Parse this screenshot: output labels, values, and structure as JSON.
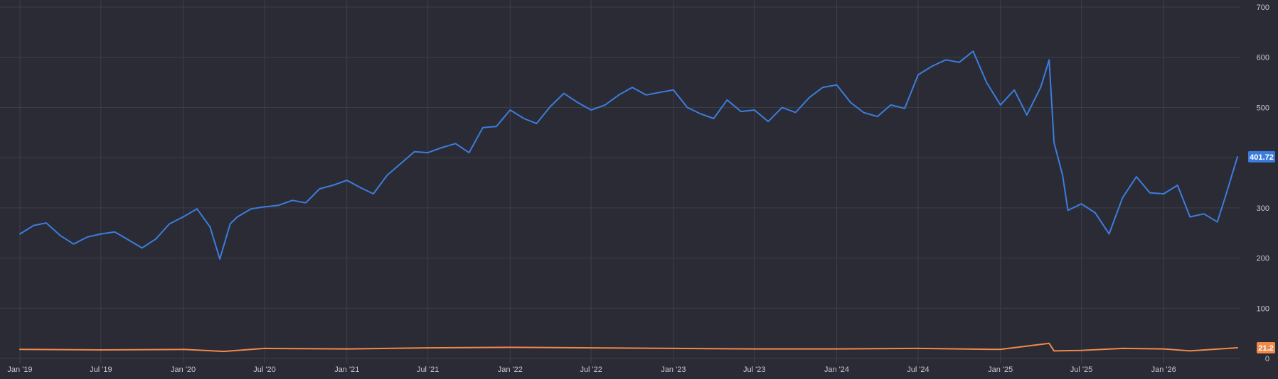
{
  "chart_data": {
    "type": "line",
    "title": "",
    "xlabel": "",
    "ylabel": "",
    "ylim": [
      0,
      700
    ],
    "yticks": [
      0,
      100,
      200,
      300,
      400,
      500,
      600,
      700
    ],
    "xticks": [
      "Jan '19",
      "Jul '19",
      "Jan '20",
      "Jul '20",
      "Jan '21",
      "Jul '21",
      "Jan '22",
      "Jul '22",
      "Jan '23",
      "Jul '23",
      "Jan '24",
      "Jul '24",
      "Jan '25",
      "Jul '25",
      "Jan '26"
    ],
    "xlim": [
      "2019-01-01",
      "2026-06-15"
    ],
    "grid": true,
    "legend": "none",
    "series": [
      {
        "color": "#3b7ddd",
        "last_value_label": "401.72",
        "points": [
          [
            "2019-01-01",
            248
          ],
          [
            "2019-02-01",
            265
          ],
          [
            "2019-03-01",
            270
          ],
          [
            "2019-04-01",
            245
          ],
          [
            "2019-05-01",
            228
          ],
          [
            "2019-06-01",
            242
          ],
          [
            "2019-07-01",
            248
          ],
          [
            "2019-08-01",
            252
          ],
          [
            "2019-09-01",
            236
          ],
          [
            "2019-10-01",
            220
          ],
          [
            "2019-11-01",
            238
          ],
          [
            "2019-12-01",
            268
          ],
          [
            "2020-01-01",
            282
          ],
          [
            "2020-02-01",
            298
          ],
          [
            "2020-03-01",
            262
          ],
          [
            "2020-03-23",
            198
          ],
          [
            "2020-04-15",
            268
          ],
          [
            "2020-05-01",
            282
          ],
          [
            "2020-06-01",
            298
          ],
          [
            "2020-07-01",
            302
          ],
          [
            "2020-08-01",
            305
          ],
          [
            "2020-09-01",
            315
          ],
          [
            "2020-10-01",
            310
          ],
          [
            "2020-11-01",
            338
          ],
          [
            "2020-12-01",
            345
          ],
          [
            "2021-01-01",
            355
          ],
          [
            "2021-02-01",
            340
          ],
          [
            "2021-03-01",
            328
          ],
          [
            "2021-04-01",
            365
          ],
          [
            "2021-05-01",
            388
          ],
          [
            "2021-06-01",
            412
          ],
          [
            "2021-07-01",
            410
          ],
          [
            "2021-08-01",
            420
          ],
          [
            "2021-09-01",
            428
          ],
          [
            "2021-10-01",
            410
          ],
          [
            "2021-11-01",
            460
          ],
          [
            "2021-12-01",
            462
          ],
          [
            "2022-01-01",
            495
          ],
          [
            "2022-02-01",
            478
          ],
          [
            "2022-03-01",
            468
          ],
          [
            "2022-04-01",
            502
          ],
          [
            "2022-05-01",
            528
          ],
          [
            "2022-06-01",
            510
          ],
          [
            "2022-07-01",
            495
          ],
          [
            "2022-08-01",
            505
          ],
          [
            "2022-09-01",
            525
          ],
          [
            "2022-10-01",
            540
          ],
          [
            "2022-11-01",
            525
          ],
          [
            "2022-12-01",
            530
          ],
          [
            "2023-01-01",
            535
          ],
          [
            "2023-02-01",
            500
          ],
          [
            "2023-03-01",
            488
          ],
          [
            "2023-04-01",
            478
          ],
          [
            "2023-05-01",
            515
          ],
          [
            "2023-06-01",
            492
          ],
          [
            "2023-07-01",
            495
          ],
          [
            "2023-08-01",
            472
          ],
          [
            "2023-09-01",
            500
          ],
          [
            "2023-10-01",
            490
          ],
          [
            "2023-11-01",
            520
          ],
          [
            "2023-12-01",
            540
          ],
          [
            "2024-01-01",
            545
          ],
          [
            "2024-02-01",
            510
          ],
          [
            "2024-03-01",
            490
          ],
          [
            "2024-04-01",
            482
          ],
          [
            "2024-05-01",
            505
          ],
          [
            "2024-06-01",
            498
          ],
          [
            "2024-07-01",
            565
          ],
          [
            "2024-08-01",
            582
          ],
          [
            "2024-09-01",
            595
          ],
          [
            "2024-10-01",
            590
          ],
          [
            "2024-11-01",
            612
          ],
          [
            "2024-12-01",
            550
          ],
          [
            "2025-01-01",
            505
          ],
          [
            "2025-02-01",
            535
          ],
          [
            "2025-03-01",
            485
          ],
          [
            "2025-04-01",
            540
          ],
          [
            "2025-04-20",
            595
          ],
          [
            "2025-05-01",
            430
          ],
          [
            "2025-05-20",
            365
          ],
          [
            "2025-06-01",
            295
          ],
          [
            "2025-07-01",
            308
          ],
          [
            "2025-08-01",
            290
          ],
          [
            "2025-09-01",
            248
          ],
          [
            "2025-10-01",
            320
          ],
          [
            "2025-11-01",
            362
          ],
          [
            "2025-12-01",
            330
          ],
          [
            "2026-01-01",
            328
          ],
          [
            "2026-02-01",
            345
          ],
          [
            "2026-03-01",
            282
          ],
          [
            "2026-04-01",
            288
          ],
          [
            "2026-05-01",
            272
          ],
          [
            "2026-05-20",
            325
          ],
          [
            "2026-06-15",
            401.72
          ]
        ]
      },
      {
        "color": "#f0894a",
        "last_value_label": "21.2",
        "points": [
          [
            "2019-01-01",
            18
          ],
          [
            "2019-07-01",
            17
          ],
          [
            "2020-01-01",
            18
          ],
          [
            "2020-04-01",
            14
          ],
          [
            "2020-07-01",
            20
          ],
          [
            "2021-01-01",
            19
          ],
          [
            "2021-07-01",
            21
          ],
          [
            "2022-01-01",
            22
          ],
          [
            "2022-07-01",
            21
          ],
          [
            "2023-01-01",
            20
          ],
          [
            "2023-07-01",
            19
          ],
          [
            "2024-01-01",
            19
          ],
          [
            "2024-07-01",
            20
          ],
          [
            "2025-01-01",
            18
          ],
          [
            "2025-04-20",
            30
          ],
          [
            "2025-05-01",
            15
          ],
          [
            "2025-07-01",
            16
          ],
          [
            "2025-10-01",
            20
          ],
          [
            "2026-01-01",
            19
          ],
          [
            "2026-03-01",
            15
          ],
          [
            "2026-06-15",
            21.2
          ]
        ]
      }
    ]
  }
}
